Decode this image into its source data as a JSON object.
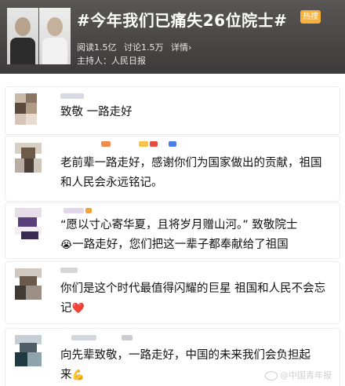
{
  "header": {
    "hashtag_title": "#今年我们已痛失26位院士#",
    "hot_badge": "热搜",
    "stats": {
      "reads": "阅读1.5亿",
      "discussions": "讨论1.5万",
      "details": "详情›"
    },
    "host": "主持人：人民日报"
  },
  "comments": [
    {
      "text": "致敬 一路走好"
    },
    {
      "text": "老前辈一路走好，感谢你们为国家做出的贡献，祖国和人民会永远铭记。"
    },
    {
      "line1": "“愿以寸心寄华夏，且将岁月赠山河。” 致敬院士",
      "emoji": "😭",
      "line2": "一路走好，您们把这一辈子都奉献给了祖国"
    },
    {
      "text": "你们是这个时代最值得闪耀的巨星 祖国和人民不会忘记",
      "emoji": "❤️"
    },
    {
      "text": "向先辈致敬，一路走好，中国的未来我们会负担起来",
      "emoji": "💪"
    }
  ],
  "watermark": "@中国青年报",
  "colors": {
    "header_bg": "#4a4747",
    "hot_badge": "#f7b13a"
  }
}
